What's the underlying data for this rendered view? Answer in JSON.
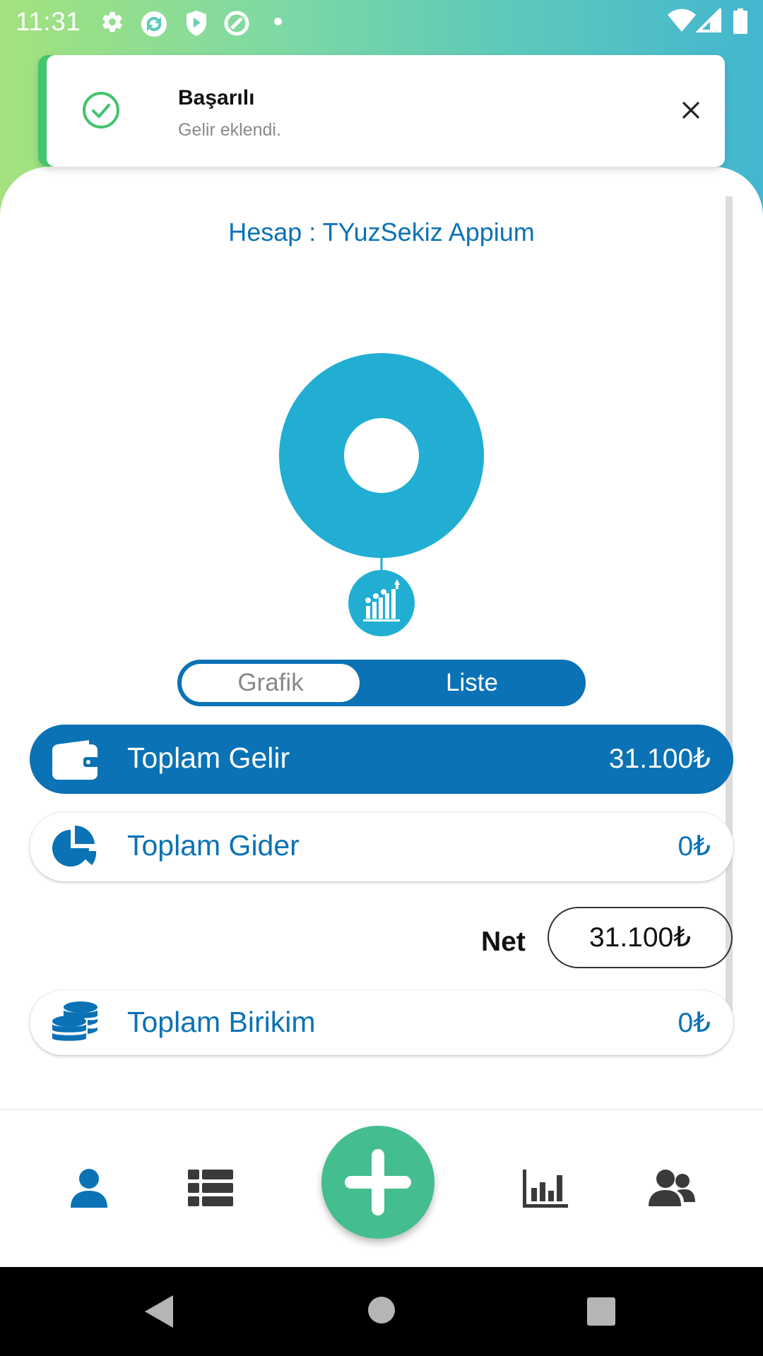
{
  "status_bar": {
    "time": "11:31",
    "left_icons": [
      "gear-icon",
      "sync-icon",
      "play-shield-icon",
      "at-sign-icon",
      "dot-icon"
    ],
    "right_icons": [
      "wifi-icon",
      "signal-icon",
      "battery-icon"
    ]
  },
  "toast": {
    "title": "Başarılı",
    "message": "Gelir eklendi.",
    "accent_color": "#43c46d"
  },
  "account": {
    "title": "Hesap : TYuzSekiz Appium"
  },
  "chart_data": {
    "type": "pie",
    "categories": [
      "Gelir"
    ],
    "values": [
      31100
    ],
    "colors": [
      "#21aed2"
    ],
    "donut": true
  },
  "view_toggle": {
    "options": [
      "Grafik",
      "Liste"
    ],
    "selected": "Grafik"
  },
  "summary": {
    "income": {
      "label": "Toplam Gelir",
      "value": "31.100₺",
      "icon": "wallet-icon"
    },
    "expense": {
      "label": "Toplam Gider",
      "value": "0₺",
      "icon": "pie-chart-icon"
    },
    "net": {
      "label": "Net",
      "value": "31.100₺"
    },
    "savings": {
      "label": "Toplam Birikim",
      "value": "0₺",
      "icon": "coins-icon"
    }
  },
  "bottom_nav": {
    "items": [
      "user-icon",
      "list-icon",
      "add-icon",
      "bar-chart-icon",
      "users-icon"
    ],
    "active": "user-icon",
    "accent": "#0a72b5",
    "fab_color": "#44bd8f"
  },
  "system_nav": [
    "back-icon",
    "home-icon",
    "recents-icon"
  ],
  "colors": {
    "primary": "#0a72b5",
    "success": "#43c46d",
    "chart": "#21aed2"
  }
}
